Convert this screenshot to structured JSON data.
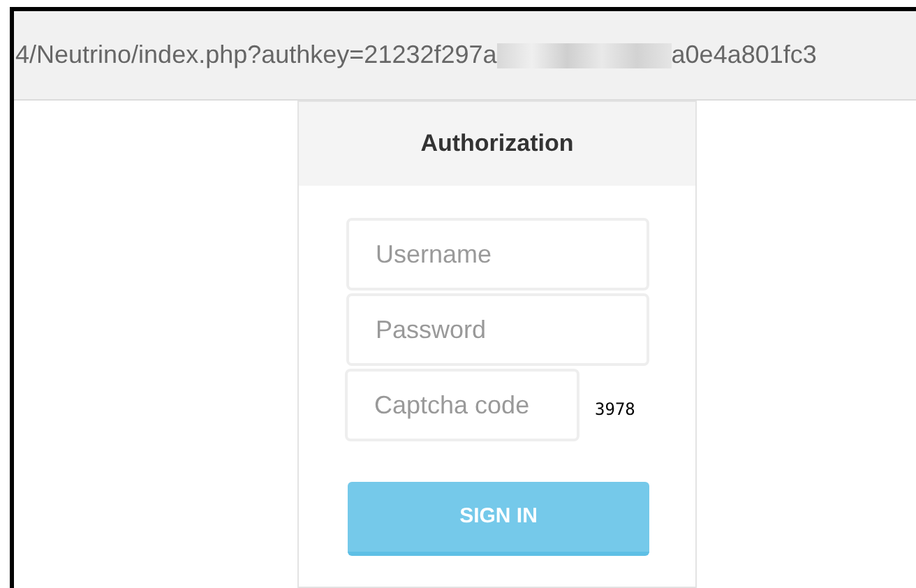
{
  "address_bar": {
    "url_start": "4/Neutrino/index.php?authkey=21232f297a",
    "url_end": "a0e4a801fc3"
  },
  "login": {
    "title": "Authorization",
    "fields": [
      {
        "placeholder": "Username"
      },
      {
        "placeholder": "Password"
      },
      {
        "placeholder": "Captcha code",
        "captcha": "3978"
      }
    ],
    "button": "SIGN IN"
  }
}
